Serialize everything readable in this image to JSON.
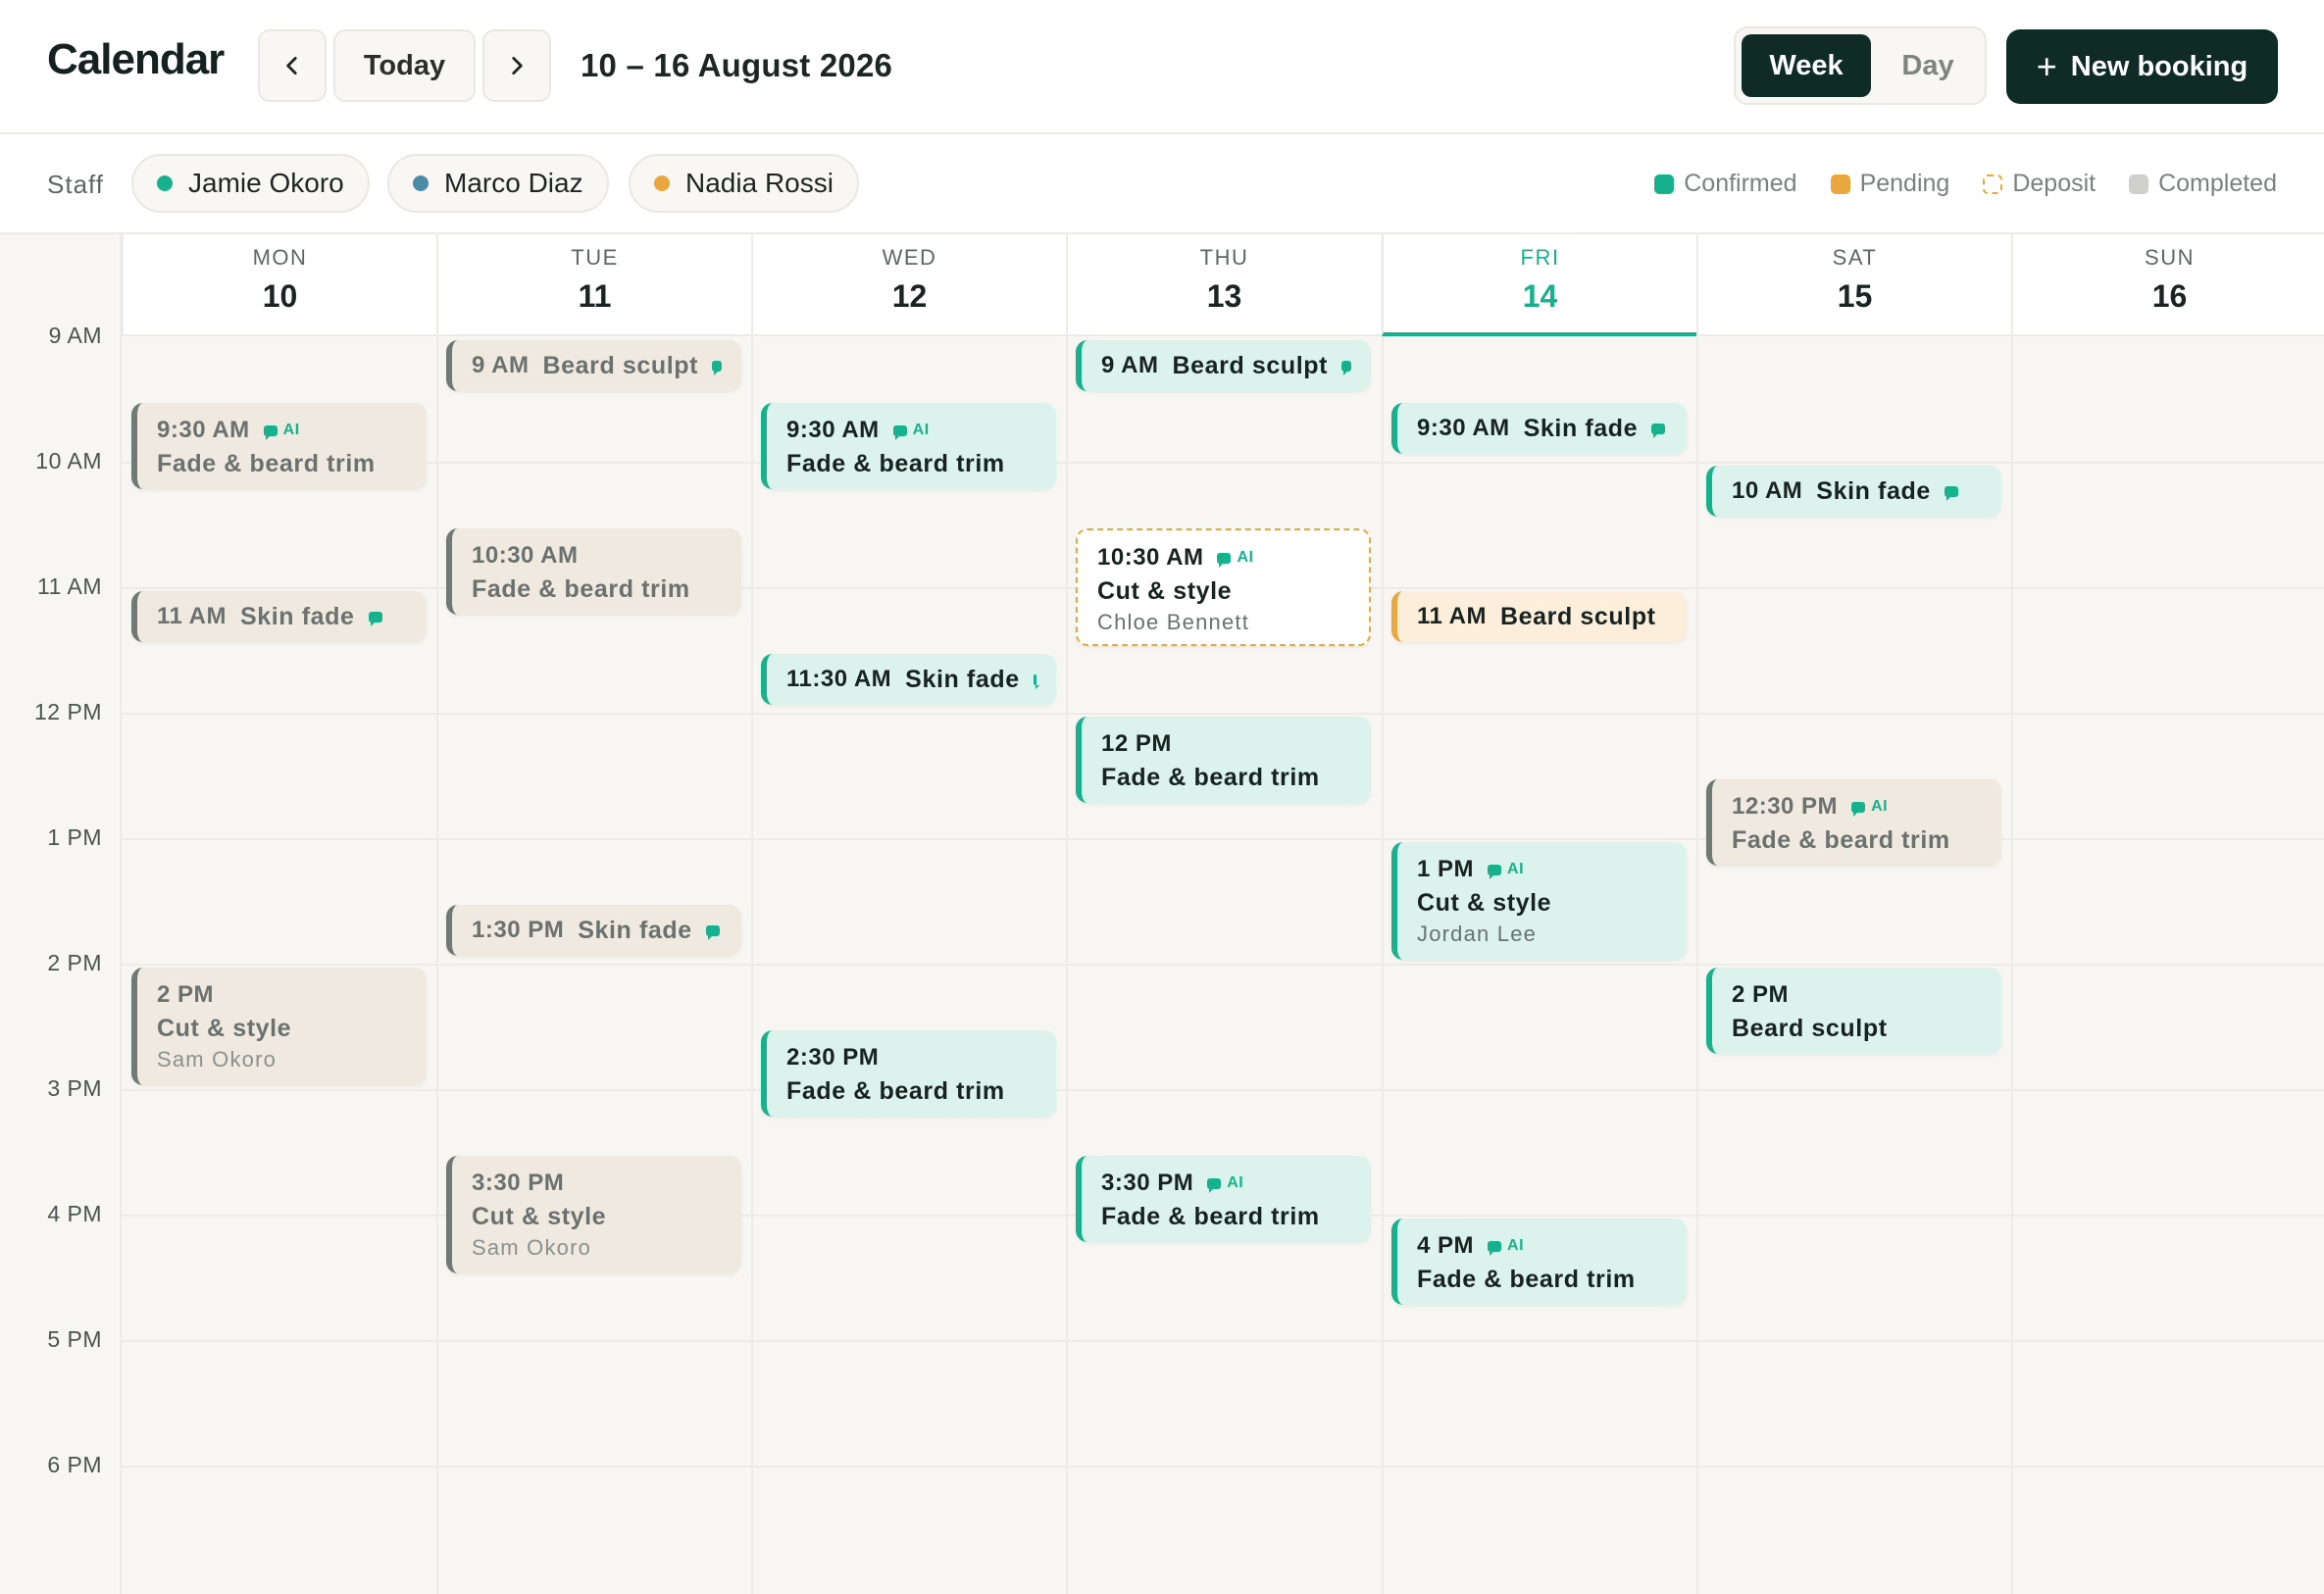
{
  "header": {
    "title": "Calendar",
    "today_label": "Today",
    "range": "10 – 16 August 2026",
    "view_week": "Week",
    "view_day": "Day",
    "new_booking": "New booking",
    "plus": "+"
  },
  "staff_bar": {
    "label": "Staff",
    "staff": [
      {
        "name": "Jamie Okoro",
        "color": "#17b28d"
      },
      {
        "name": "Marco Diaz",
        "color": "#4a8ba7"
      },
      {
        "name": "Nadia Rossi",
        "color": "#e9a73d"
      }
    ],
    "legend": {
      "confirmed": "Confirmed",
      "pending": "Pending",
      "deposit": "Deposit",
      "completed": "Completed"
    }
  },
  "colors": {
    "accent": "#17b28d",
    "dark": "#0f2b26",
    "pending": "#e9a73d",
    "completed": "#6f7976"
  },
  "ai_label": "AI",
  "days": [
    {
      "dow": "MON",
      "num": "10"
    },
    {
      "dow": "TUE",
      "num": "11"
    },
    {
      "dow": "WED",
      "num": "12"
    },
    {
      "dow": "THU",
      "num": "13"
    },
    {
      "dow": "FRI",
      "num": "14"
    },
    {
      "dow": "SAT",
      "num": "15"
    },
    {
      "dow": "SUN",
      "num": "16"
    }
  ],
  "hours": [
    "9 AM",
    "10 AM",
    "11 AM",
    "12 PM",
    "1 PM",
    "2 PM",
    "3 PM",
    "4 PM",
    "5 PM",
    "6 PM"
  ],
  "bookings": [
    {
      "day": 0,
      "start": "9:30 AM",
      "service": "Fade & beard trim",
      "status": "completed",
      "ai": true,
      "message": true
    },
    {
      "day": 0,
      "start": "11 AM",
      "service": "Skin fade",
      "status": "completed",
      "message": true
    },
    {
      "day": 0,
      "start": "2 PM",
      "service": "Cut & style",
      "client": "Sam Okoro",
      "status": "completed"
    },
    {
      "day": 1,
      "start": "9 AM",
      "service": "Beard sculpt",
      "status": "completed",
      "message": true
    },
    {
      "day": 1,
      "start": "10:30 AM",
      "service": "Fade & beard trim",
      "status": "completed"
    },
    {
      "day": 1,
      "start": "1:30 PM",
      "service": "Skin fade",
      "status": "completed",
      "message": true
    },
    {
      "day": 1,
      "start": "3:30 PM",
      "service": "Cut & style",
      "client": "Sam Okoro",
      "status": "completed"
    },
    {
      "day": 2,
      "start": "9:30 AM",
      "service": "Fade & beard trim",
      "status": "confirmed",
      "ai": true,
      "message": true
    },
    {
      "day": 2,
      "start": "11:30 AM",
      "service": "Skin fade",
      "status": "confirmed",
      "message": true
    },
    {
      "day": 2,
      "start": "2:30 PM",
      "service": "Fade & beard trim",
      "status": "confirmed"
    },
    {
      "day": 3,
      "start": "9 AM",
      "service": "Beard sculpt",
      "status": "confirmed",
      "message": true
    },
    {
      "day": 3,
      "start": "10:30 AM",
      "service": "Cut & style",
      "client": "Chloe Bennett",
      "status": "deposit",
      "ai": true,
      "message": true
    },
    {
      "day": 3,
      "start": "12 PM",
      "service": "Fade & beard trim",
      "status": "confirmed"
    },
    {
      "day": 3,
      "start": "3:30 PM",
      "service": "Fade & beard trim",
      "status": "confirmed",
      "ai": true,
      "message": true
    },
    {
      "day": 4,
      "start": "9:30 AM",
      "service": "Skin fade",
      "status": "confirmed",
      "message": true
    },
    {
      "day": 4,
      "start": "11 AM",
      "service": "Beard sculpt",
      "status": "pending"
    },
    {
      "day": 4,
      "start": "1 PM",
      "service": "Cut & style",
      "client": "Jordan Lee",
      "status": "confirmed",
      "ai": true,
      "message": true
    },
    {
      "day": 4,
      "start": "4 PM",
      "service": "Fade & beard trim",
      "status": "confirmed",
      "ai": true,
      "message": true
    },
    {
      "day": 5,
      "start": "10 AM",
      "service": "Skin fade",
      "status": "confirmed",
      "message": true
    },
    {
      "day": 5,
      "start": "12:30 PM",
      "service": "Fade & beard trim",
      "status": "completed",
      "ai": true,
      "message": true
    },
    {
      "day": 5,
      "start": "2 PM",
      "service": "Beard sculpt",
      "status": "confirmed"
    }
  ]
}
